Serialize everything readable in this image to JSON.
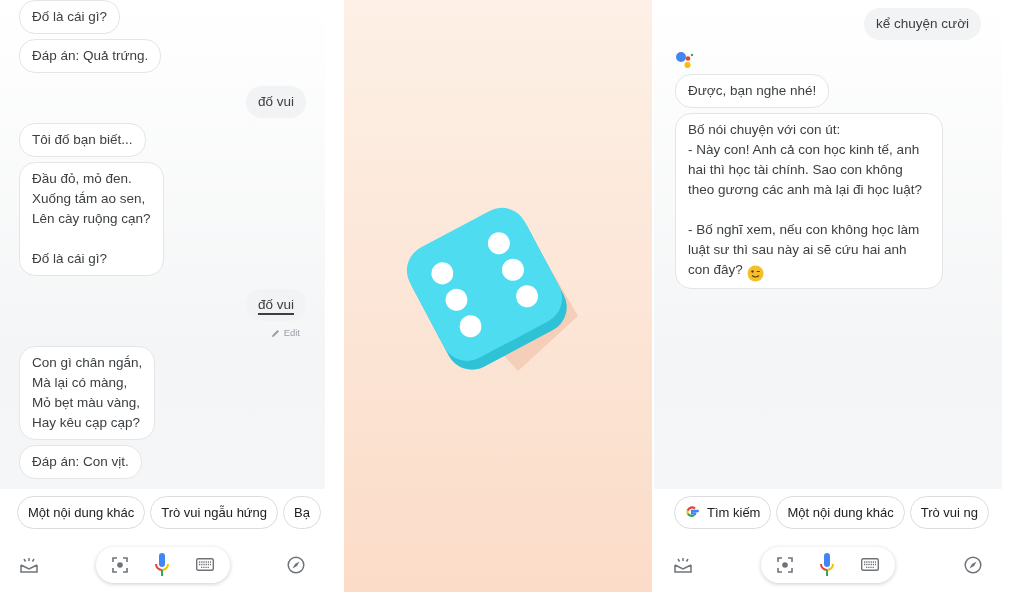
{
  "panels": [
    {
      "kind": "chat",
      "messages": [
        {
          "kind": "assistant",
          "text": "Đố là cái gì?",
          "avatar": false
        },
        {
          "kind": "assistant",
          "text": "Đáp án: Quả trứng.",
          "avatar": false
        },
        {
          "kind": "user",
          "text": "đố vui",
          "underlined": false
        },
        {
          "kind": "assistant",
          "text": "Tôi đố bạn biết...",
          "avatar": false
        },
        {
          "kind": "assistant",
          "text": "Đầu đỏ, mỏ đen.\nXuống tắm ao sen,\nLên cày ruộng cạn?\n\nĐố là cái gì?",
          "avatar": false
        },
        {
          "kind": "user",
          "text": "đố vui",
          "underlined": true,
          "edit_label": "Edit"
        },
        {
          "kind": "assistant",
          "text": "Con gì chân ngắn,\nMà lại có màng,\nMỏ bẹt màu vàng,\nHay kêu cạp cạp?",
          "avatar": false
        },
        {
          "kind": "assistant",
          "text": "Đáp án: Con vịt.",
          "avatar": false
        }
      ],
      "suggestions": [
        {
          "kind": "plain",
          "label": "Một nội dung khác"
        },
        {
          "kind": "plain",
          "label": "Trò vui ngẫu hứng"
        },
        {
          "kind": "plain",
          "label": "Bạ"
        }
      ]
    },
    {
      "kind": "dice"
    },
    {
      "kind": "chat",
      "messages": [
        {
          "kind": "user",
          "text": "kể chuyện cười",
          "underlined": false
        },
        {
          "kind": "assistant",
          "text": "Được, bạn nghe nhé!",
          "avatar": true
        },
        {
          "kind": "assistant",
          "text": "Bố nói chuyện với con út:\n- Này con! Anh cả con học kinh tế, anh hai thì học tài chính. Sao con không theo gương các anh mà lại đi học luật?\n\n- Bố nghĩ xem, nếu con không học làm luật sư thì sau này ai sẽ cứu hai anh con đây?",
          "avatar": false,
          "emoji": true
        }
      ],
      "suggestions": [
        {
          "kind": "search",
          "label": "Tìm kiếm"
        },
        {
          "kind": "plain",
          "label": "Một nội dung khác"
        },
        {
          "kind": "plain",
          "label": "Trò vui ng"
        }
      ]
    }
  ]
}
